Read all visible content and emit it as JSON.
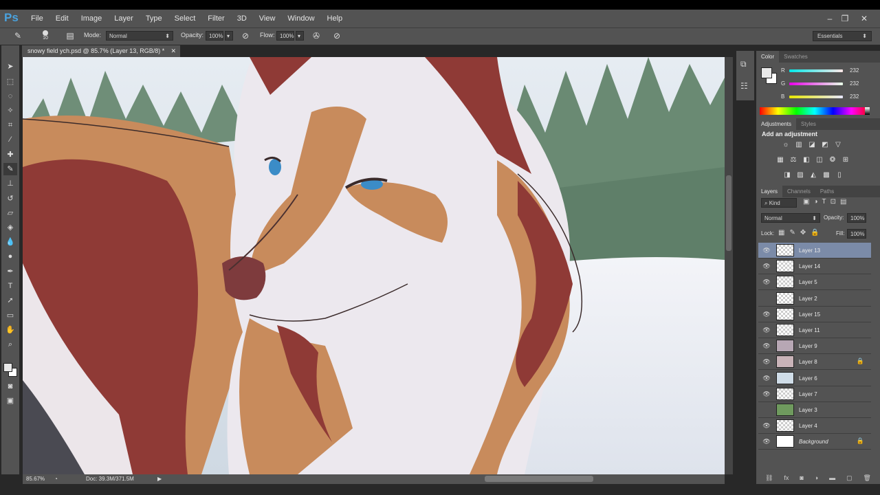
{
  "app": {
    "logo": "Ps"
  },
  "menu": [
    "File",
    "Edit",
    "Image",
    "Layer",
    "Type",
    "Select",
    "Filter",
    "3D",
    "View",
    "Window",
    "Help"
  ],
  "window_controls": {
    "minimize": "–",
    "restore": "❐",
    "close": "✕"
  },
  "options": {
    "brush_size": "10",
    "mode_label": "Mode:",
    "mode_value": "Normal",
    "opacity_label": "Opacity:",
    "opacity_value": "100%",
    "flow_label": "Flow:",
    "flow_value": "100%",
    "workspace": "Essentials"
  },
  "document": {
    "tab_title": "snowy field ych.psd @ 85.7% (Layer 13, RGB/8) *",
    "zoom": "85.67%",
    "doc_info": "Doc: 39.3M/371.5M"
  },
  "color_panel": {
    "tabs": [
      "Color",
      "Swatches"
    ],
    "r": "232",
    "g": "232",
    "b": "232",
    "r_label": "R",
    "g_label": "G",
    "b_label": "B",
    "foreground": "#e8e8e8"
  },
  "adjustments_panel": {
    "tabs": [
      "Adjustments",
      "Styles"
    ],
    "heading": "Add an adjustment"
  },
  "layers_panel": {
    "tabs": [
      "Layers",
      "Channels",
      "Paths"
    ],
    "filter": "Kind",
    "blend_mode": "Normal",
    "opacity_label": "Opacity:",
    "opacity_value": "100%",
    "lock_label": "Lock:",
    "fill_label": "Fill:",
    "fill_value": "100%",
    "layers": [
      {
        "name": "Layer 13",
        "visible": true,
        "selected": true,
        "locked": false
      },
      {
        "name": "Layer 14",
        "visible": true,
        "selected": false,
        "locked": false
      },
      {
        "name": "Layer 5",
        "visible": true,
        "selected": false,
        "locked": false
      },
      {
        "name": "Layer 2",
        "visible": false,
        "selected": false,
        "locked": false
      },
      {
        "name": "Layer 15",
        "visible": true,
        "selected": false,
        "locked": false
      },
      {
        "name": "Layer 11",
        "visible": true,
        "selected": false,
        "locked": false
      },
      {
        "name": "Layer 9",
        "visible": true,
        "selected": false,
        "locked": false
      },
      {
        "name": "Layer 8",
        "visible": true,
        "selected": false,
        "locked": true
      },
      {
        "name": "Layer 6",
        "visible": true,
        "selected": false,
        "locked": false
      },
      {
        "name": "Layer 7",
        "visible": true,
        "selected": false,
        "locked": false
      },
      {
        "name": "Layer 3",
        "visible": false,
        "selected": false,
        "locked": false
      },
      {
        "name": "Layer 4",
        "visible": true,
        "selected": false,
        "locked": false
      },
      {
        "name": "Background",
        "visible": true,
        "selected": false,
        "locked": true
      }
    ]
  }
}
